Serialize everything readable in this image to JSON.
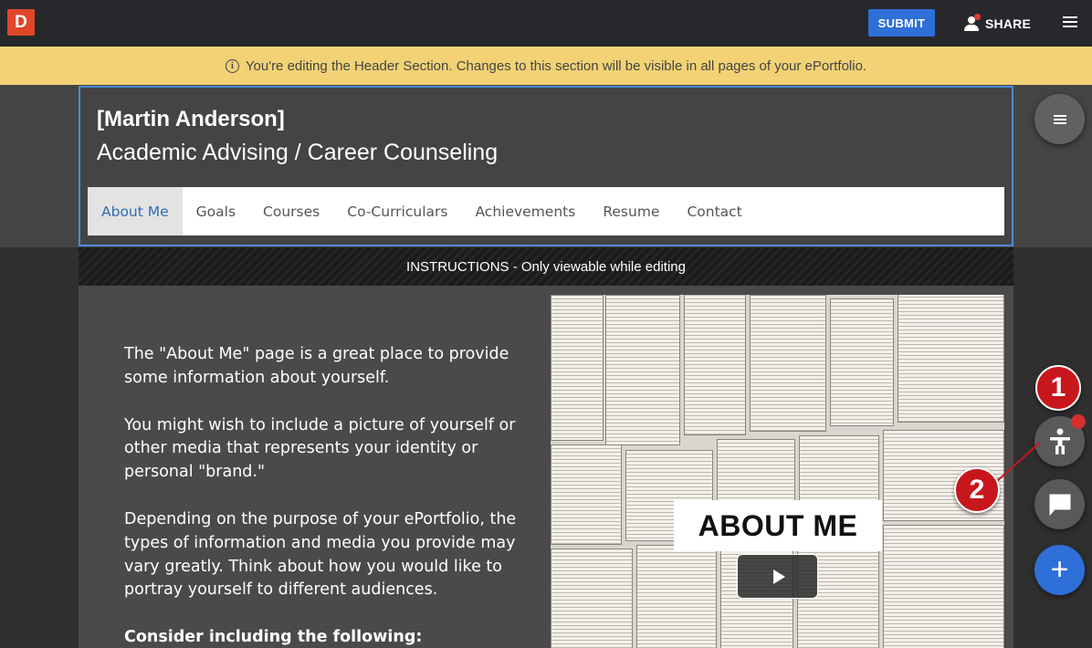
{
  "topbar": {
    "logo_letter": "D",
    "submit_label": "SUBMIT",
    "share_label": "SHARE",
    "menu_icon": "hamburger-icon",
    "share_icon": "person-icon"
  },
  "notice": {
    "icon": "info-icon",
    "info_glyph": "i",
    "text": "You're editing the Header Section. Changes to this section will be visible in all pages of your ePortfolio."
  },
  "header": {
    "name": "[Martin Anderson]",
    "subtitle": "Academic Advising / Career Counseling"
  },
  "nav": {
    "items": [
      "About Me",
      "Goals",
      "Courses",
      "Co-Curriculars",
      "Achievements",
      "Resume",
      "Contact"
    ],
    "active": "About Me"
  },
  "instructions": {
    "text": "INSTRUCTIONS - Only viewable while editing"
  },
  "content": {
    "p1": "The \"About Me\" page is a great place to provide some information about yourself.",
    "p2": "You might wish to include a picture of yourself or other media that represents your identity or personal \"brand.\"",
    "p3": "Depending on the purpose of your ePortfolio, the types of information and media you provide may vary greatly. Think about how you would like to portray yourself to different audiences.",
    "p4": "Consider including the following:",
    "image_title": "ABOUT ME"
  },
  "fabs": {
    "menu_icon": "menu-icon",
    "accessibility_icon": "accessibility-icon",
    "chat_icon": "chat-icon",
    "add_label": "+"
  },
  "callouts": {
    "one": "1",
    "two": "2"
  },
  "colors": {
    "accent_blue": "#2f6fd8",
    "notice_yellow": "#f2d275",
    "callout_red": "#c8161d",
    "logo_orange": "#e0462a"
  }
}
